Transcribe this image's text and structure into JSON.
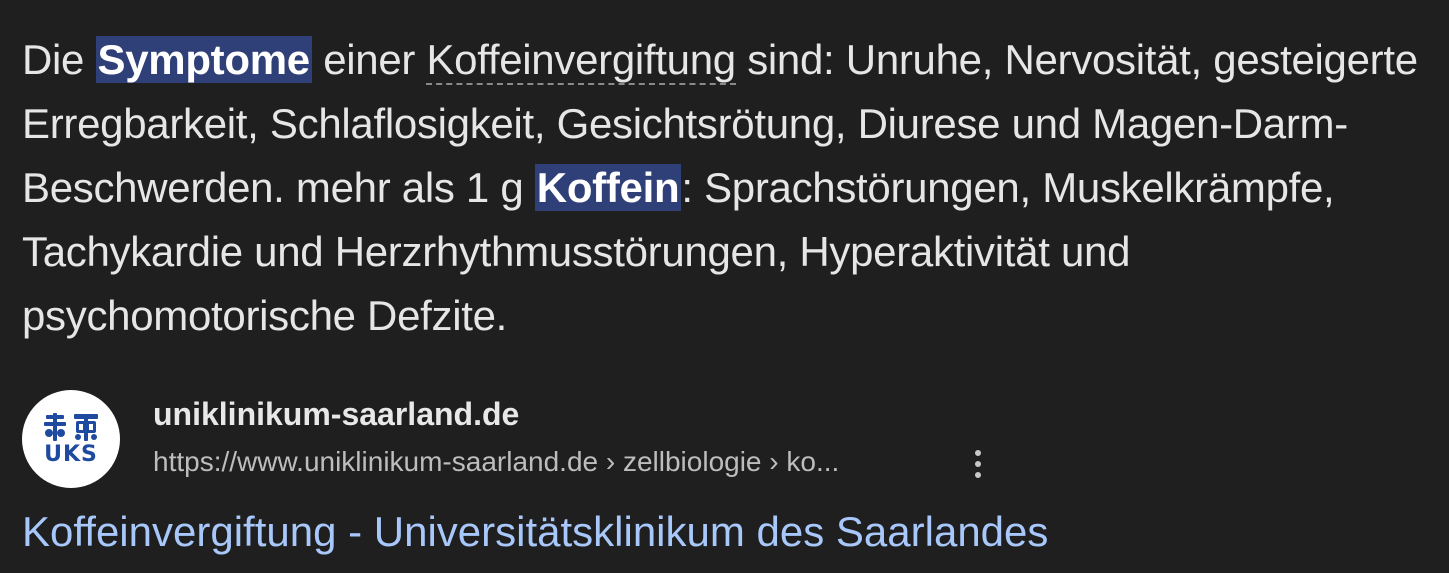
{
  "snippet": {
    "p1": "Die ",
    "hl1": "Symptome",
    "p2": " einer ",
    "term": "Koffeinvergiftung",
    "p3": " sind: Unruhe, Nervosität, gesteigerte Erregbarkeit, Schlaflosigkeit, Gesichtsrötung, Diurese und Magen-Darm-Beschwerden. mehr als 1 g ",
    "hl2": "Koffein",
    "p4": ": Sprachstörungen, Muskelkrämpfe, Tachykardie und Herzrhythmusstörungen, Hyperaktivität und psychomotorische Defzite."
  },
  "source": {
    "favicon_text": "UKS",
    "favicon_icon": "uks-logo-icon",
    "site_name": "uniklinikum-saarland.de",
    "url": "https://www.uniklinikum-saarland.de › zellbiologie › ko...",
    "more_icon": "more-vert-icon"
  },
  "result": {
    "title": "Koffeinvergiftung - Universitätsklinikum des Saarlandes"
  },
  "colors": {
    "background": "#1f1f1f",
    "highlight": "#2f3f77",
    "link": "#a8c7fa",
    "logo_blue": "#1e4aa0"
  }
}
